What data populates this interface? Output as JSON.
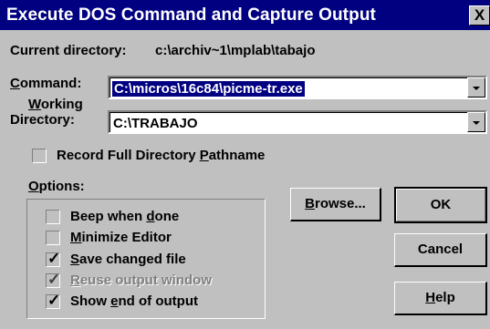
{
  "window": {
    "title": "Execute DOS Command and Capture Output",
    "close_glyph": "X"
  },
  "current_directory": {
    "label": "Current directory:",
    "value": "c:\\archiv~1\\mplab\\tabajo"
  },
  "command": {
    "label": "Command:",
    "value": "C:\\micros\\16c84\\picme-tr.exe",
    "selected": true
  },
  "working_directory": {
    "label_line1": "Working",
    "label_line2": "Directory:",
    "value": "C:\\TRABAJO"
  },
  "record_full_path": {
    "label": "Record Full Directory Pathname",
    "checked": false
  },
  "options": {
    "label": "Options:",
    "items": [
      {
        "label": "Beep when done",
        "checked": false,
        "enabled": true
      },
      {
        "label": "Minimize Editor",
        "checked": false,
        "enabled": true
      },
      {
        "label": "Save changed file",
        "checked": true,
        "enabled": true
      },
      {
        "label": "Reuse output window",
        "checked": true,
        "enabled": false
      },
      {
        "label": "Show end of output",
        "checked": true,
        "enabled": true
      }
    ]
  },
  "buttons": {
    "browse": "Browse...",
    "ok": "OK",
    "cancel": "Cancel",
    "help": "Help"
  },
  "icons": {
    "dropdown": "chevron-down-icon",
    "close": "close-icon",
    "check": "checkmark-icon"
  },
  "colors": {
    "titlebar": "#000080",
    "face": "#c0c0c0",
    "selection": "#000080"
  }
}
